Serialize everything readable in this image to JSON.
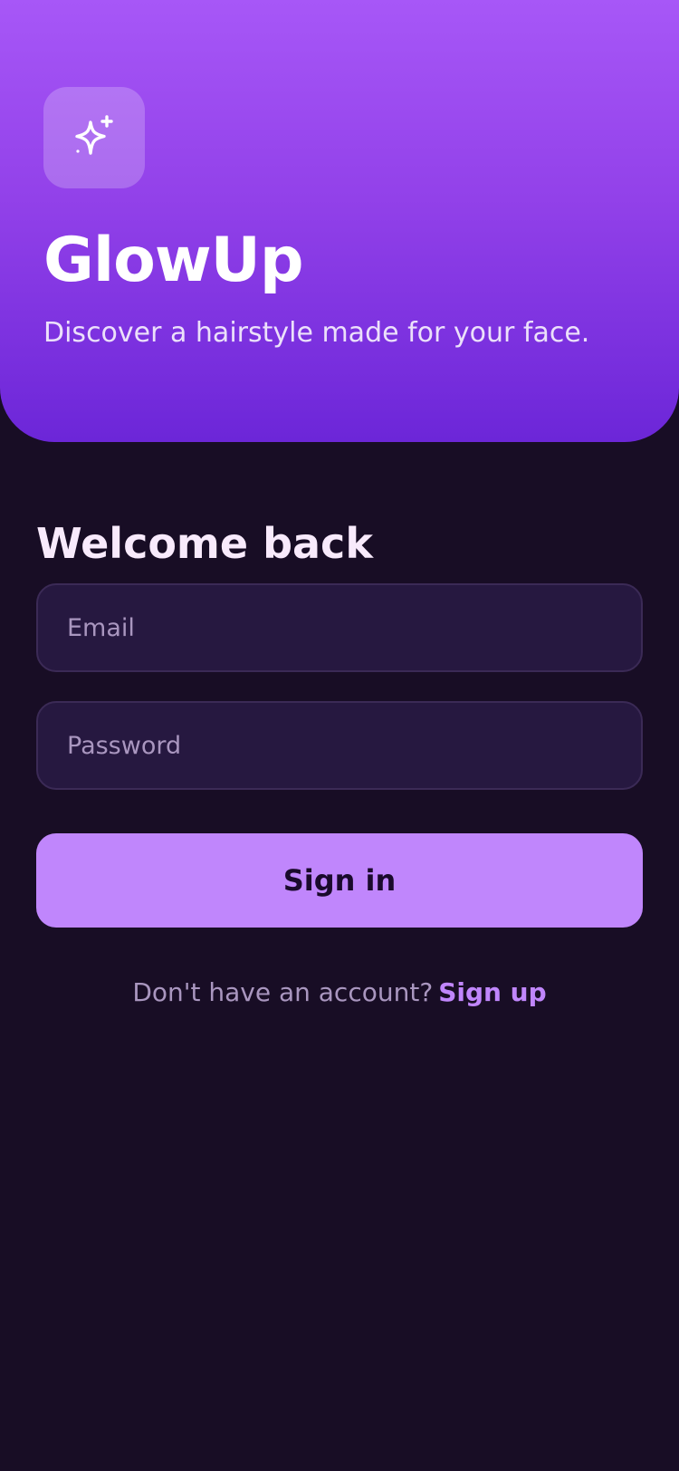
{
  "header": {
    "app_name": "GlowUp",
    "tagline": "Discover a hairstyle made for your face.",
    "logo_icon": "sparkles-icon"
  },
  "login": {
    "title": "Welcome back",
    "email": {
      "placeholder": "Email",
      "value": ""
    },
    "password": {
      "placeholder": "Password",
      "value": ""
    },
    "submit_label": "Sign in",
    "signup_prompt": "Don't have an account?",
    "signup_link": "Sign up"
  },
  "colors": {
    "background": "#180d25",
    "hero_gradient_top": "#a757f7",
    "hero_gradient_bottom": "#6c26d8",
    "field_background": "#261840",
    "accent": "#c086fc"
  }
}
